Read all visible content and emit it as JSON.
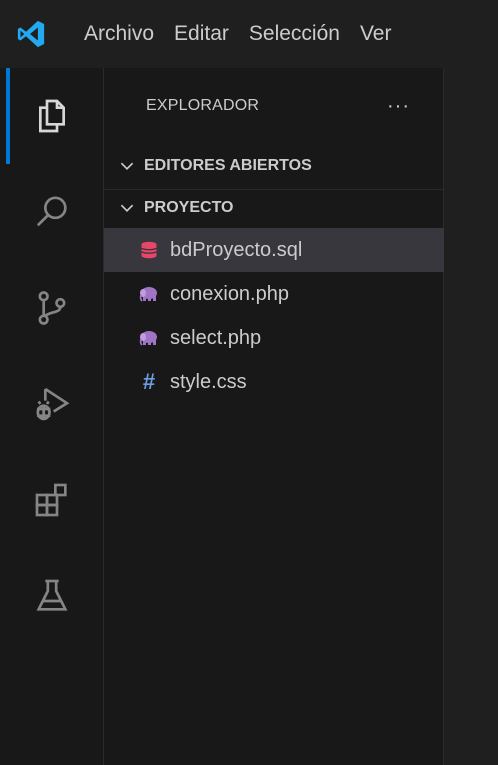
{
  "titlebar": {
    "menu": [
      "Archivo",
      "Editar",
      "Selección",
      "Ver"
    ]
  },
  "activity_bar": {
    "items": [
      "explorer-icon",
      "search-icon",
      "source-control-icon",
      "run-debug-icon",
      "extensions-icon",
      "testing-icon"
    ],
    "active_index": 0
  },
  "explorer": {
    "title": "EXPLORADOR",
    "more": "···",
    "open_editors_label": "EDITORES ABIERTOS",
    "project_label": "PROYECTO",
    "files": [
      {
        "name": "bdProyecto.sql",
        "icon": "database-icon",
        "selected": true
      },
      {
        "name": "conexion.php",
        "icon": "php-elephant-icon",
        "selected": false
      },
      {
        "name": "select.php",
        "icon": "php-elephant-icon",
        "selected": false
      },
      {
        "name": "style.css",
        "icon": "css-hash-icon",
        "selected": false
      }
    ]
  },
  "colors": {
    "accent": "#0078d4",
    "vscode_logo": "#23a9f2",
    "sql_icon": "#e8456b",
    "php_icon": "#a074c4",
    "css_icon": "#6b9ee5",
    "selection": "#37373d"
  }
}
